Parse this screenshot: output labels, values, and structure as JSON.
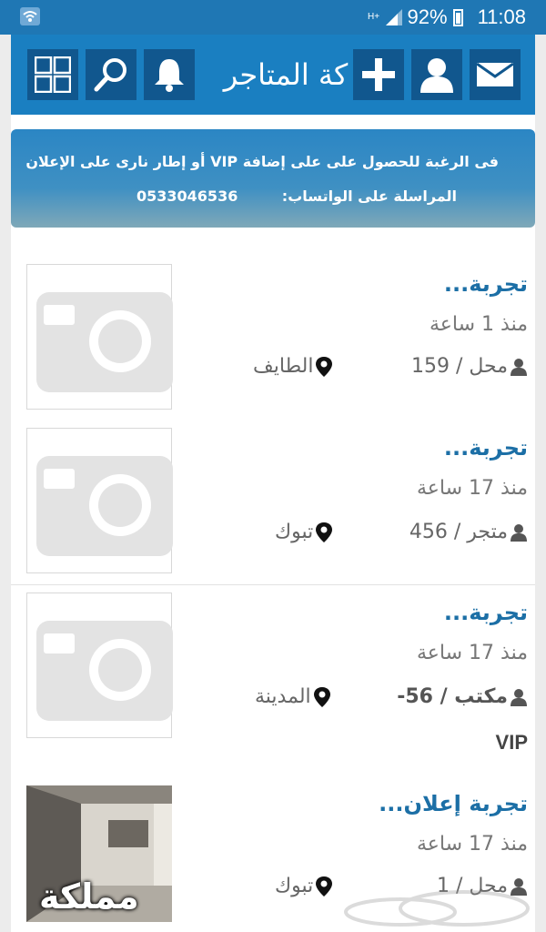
{
  "status_bar": {
    "battery": "92%",
    "time": "11:08",
    "network": "H+"
  },
  "header": {
    "title": "كة المتاجر"
  },
  "banner": {
    "line1": "فى الرغبة للحصول على على إضافة VIP أو إطار نارى على الإعلان",
    "line2": "المراسلة على الواتساب:",
    "phone": "0533046536"
  },
  "listings": [
    {
      "title": "تجربة...",
      "time": "منذ 1 ساعة",
      "type": "محل / 159",
      "location": "الطايف"
    },
    {
      "title": "تجربة...",
      "time": "منذ 17 ساعة",
      "type": "متجر / 456",
      "location": "تبوك"
    },
    {
      "title": "تجربة...",
      "time": "منذ 17 ساعة",
      "type": "مكتب / 56-",
      "location": "المدينة",
      "badge": "VIP"
    },
    {
      "title": "تجربة إعلان...",
      "time": "منذ 17 ساعة",
      "type": "محل / 1",
      "location": "تبوك",
      "photo_text": "مملكة"
    }
  ],
  "colors": {
    "status_bar": "#1f77b4",
    "app_bar": "#1a7fc1",
    "app_button": "#11578e",
    "title_link": "#1c6fa6"
  },
  "icons": [
    "wifi-icon",
    "signal-icon",
    "battery-icon",
    "grid-icon",
    "search-icon",
    "bell-icon",
    "plus-icon",
    "user-icon",
    "mail-icon",
    "camera-placeholder-icon",
    "person-icon",
    "location-pin-icon"
  ]
}
